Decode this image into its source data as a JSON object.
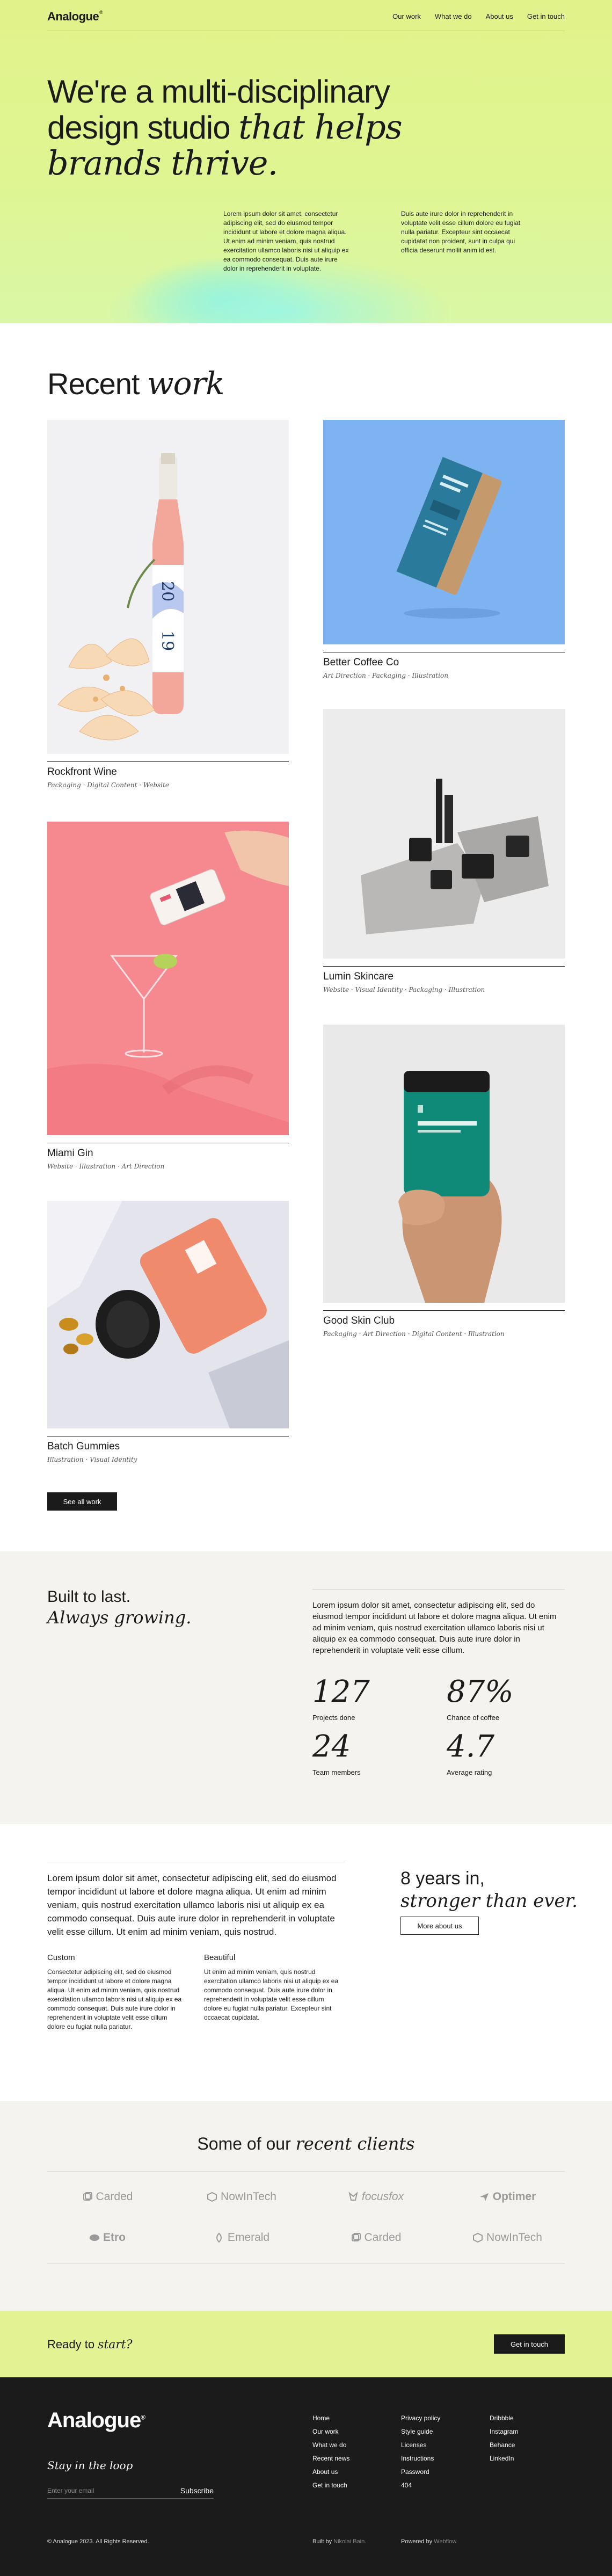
{
  "brand": {
    "name": "Analogue",
    "mark": "®"
  },
  "nav": {
    "links": [
      "Our work",
      "What we do",
      "About us",
      "Get in touch"
    ]
  },
  "hero": {
    "line1": "We're a multi-disciplinary",
    "line2a": "design studio ",
    "line2b": "that helps",
    "line3": "brands thrive.",
    "p1": "Lorem ipsum dolor sit amet, consectetur adipiscing elit, sed do eiusmod tempor incididunt ut labore et dolore magna aliqua. Ut enim ad minim veniam, quis nostrud exercitation ullamco laboris nisi ut aliquip ex ea commodo consequat. Duis aute irure dolor in reprehenderit in voluptate.",
    "p2": "Duis aute irure dolor in reprehenderit in voluptate velit esse cillum dolore eu fugiat nulla pariatur. Excepteur sint occaecat cupidatat non proident, sunt in culpa qui officia deserunt mollit anim id est."
  },
  "recent": {
    "title_a": "Recent ",
    "title_b": "work",
    "projects": [
      {
        "title": "Rockfront Wine",
        "tags": "Packaging · Digital Content · Website"
      },
      {
        "title": "Better Coffee Co",
        "tags": "Art Direction · Packaging · Illustration"
      },
      {
        "title": "Lumin Skincare",
        "tags": "Website · Visual Identity · Packaging · Illustration"
      },
      {
        "title": "Miami Gin",
        "tags": "Website · Illustration · Art Direction"
      },
      {
        "title": "Good Skin Club",
        "tags": "Packaging · Art Direction · Digital Content · Illustration"
      },
      {
        "title": "Batch Gummies",
        "tags": "Illustration · Visual Identity"
      }
    ],
    "see_all": "See all work"
  },
  "stats": {
    "title_a": "Built to last.",
    "title_b": "Always growing.",
    "text": "Lorem ipsum dolor sit amet, consectetur adipiscing elit, sed do eiusmod tempor incididunt ut labore et dolore magna aliqua. Ut enim ad minim veniam, quis nostrud exercitation ullamco laboris nisi ut aliquip ex ea commodo consequat. Duis aute irure dolor in reprehenderit in voluptate velit esse cillum.",
    "items": [
      {
        "value": "127",
        "label": "Projects done"
      },
      {
        "value": "87%",
        "label": "Chance of coffee"
      },
      {
        "value": "24",
        "label": "Team members"
      },
      {
        "value": "4.7",
        "label": "Average rating"
      }
    ]
  },
  "about": {
    "lead": "Lorem ipsum dolor sit amet, consectetur adipiscing elit, sed do eiusmod tempor incididunt ut labore et dolore magna aliqua. Ut enim ad minim veniam, quis nostrud exercitation ullamco laboris nisi ut aliquip ex ea commodo consequat. Duis aute irure dolor in reprehenderit in voluptate velit esse cillum. Ut enim ad minim veniam, quis nostrud.",
    "col1_title": "Custom",
    "col1_text": "Consectetur adipiscing elit, sed do eiusmod tempor incididunt ut labore et dolore magna aliqua. Ut enim ad minim veniam, quis nostrud exercitation ullamco laboris nisi ut aliquip ex ea commodo consequat. Duis aute irure dolor in reprehenderit in voluptate velit esse cillum dolore eu fugiat nulla pariatur.",
    "col2_title": "Beautiful",
    "col2_text": "Ut enim ad minim veniam, quis nostrud exercitation ullamco laboris nisi ut aliquip ex ea commodo consequat. Duis aute irure dolor in reprehenderit in voluptate velit esse cillum dolore eu fugiat nulla pariatur. Excepteur sint occaecat cupidatat.",
    "years_a": "8 years in,",
    "years_b": "stronger than ever.",
    "more": "More about us"
  },
  "clients": {
    "title_a": "Some of our ",
    "title_b": "recent clients",
    "logos": [
      {
        "name": "Carded",
        "icon": "stack-icon"
      },
      {
        "name": "NowInTech",
        "icon": "box-icon"
      },
      {
        "name": "focusfox",
        "icon": "fox-icon"
      },
      {
        "name": "Optimer",
        "icon": "arrow-icon"
      },
      {
        "name": "Etro",
        "icon": "blob-icon"
      },
      {
        "name": "Emerald",
        "icon": "leaf-icon"
      },
      {
        "name": "Carded",
        "icon": "stack-icon"
      },
      {
        "name": "NowInTech",
        "icon": "box-icon"
      }
    ]
  },
  "cta": {
    "text_a": "Ready to ",
    "text_b": "start?",
    "button": "Get in touch"
  },
  "footer": {
    "stay": "Stay in the loop",
    "email_placeholder": "Enter your email",
    "subscribe": "Subscribe",
    "col1": [
      "Home",
      "Our work",
      "What we do",
      "Recent news",
      "About us",
      "Get in touch"
    ],
    "col2": [
      "Privacy policy",
      "Style guide",
      "Licenses",
      "Instructions",
      "Password",
      "404"
    ],
    "col3": [
      "Dribbble",
      "Instagram",
      "Behance",
      "LinkedIn"
    ],
    "copyright": "© Analogue 2023. All Rights Reserved.",
    "built_a": "Built by ",
    "built_b": "Nikolai Bain.",
    "powered_a": "Powered by ",
    "powered_b": "Webflow."
  },
  "colors": {
    "lime": "#e2f28a",
    "mint": "#9ef6e2",
    "dark": "#1b1b1b",
    "light": "#f4f3f0"
  }
}
